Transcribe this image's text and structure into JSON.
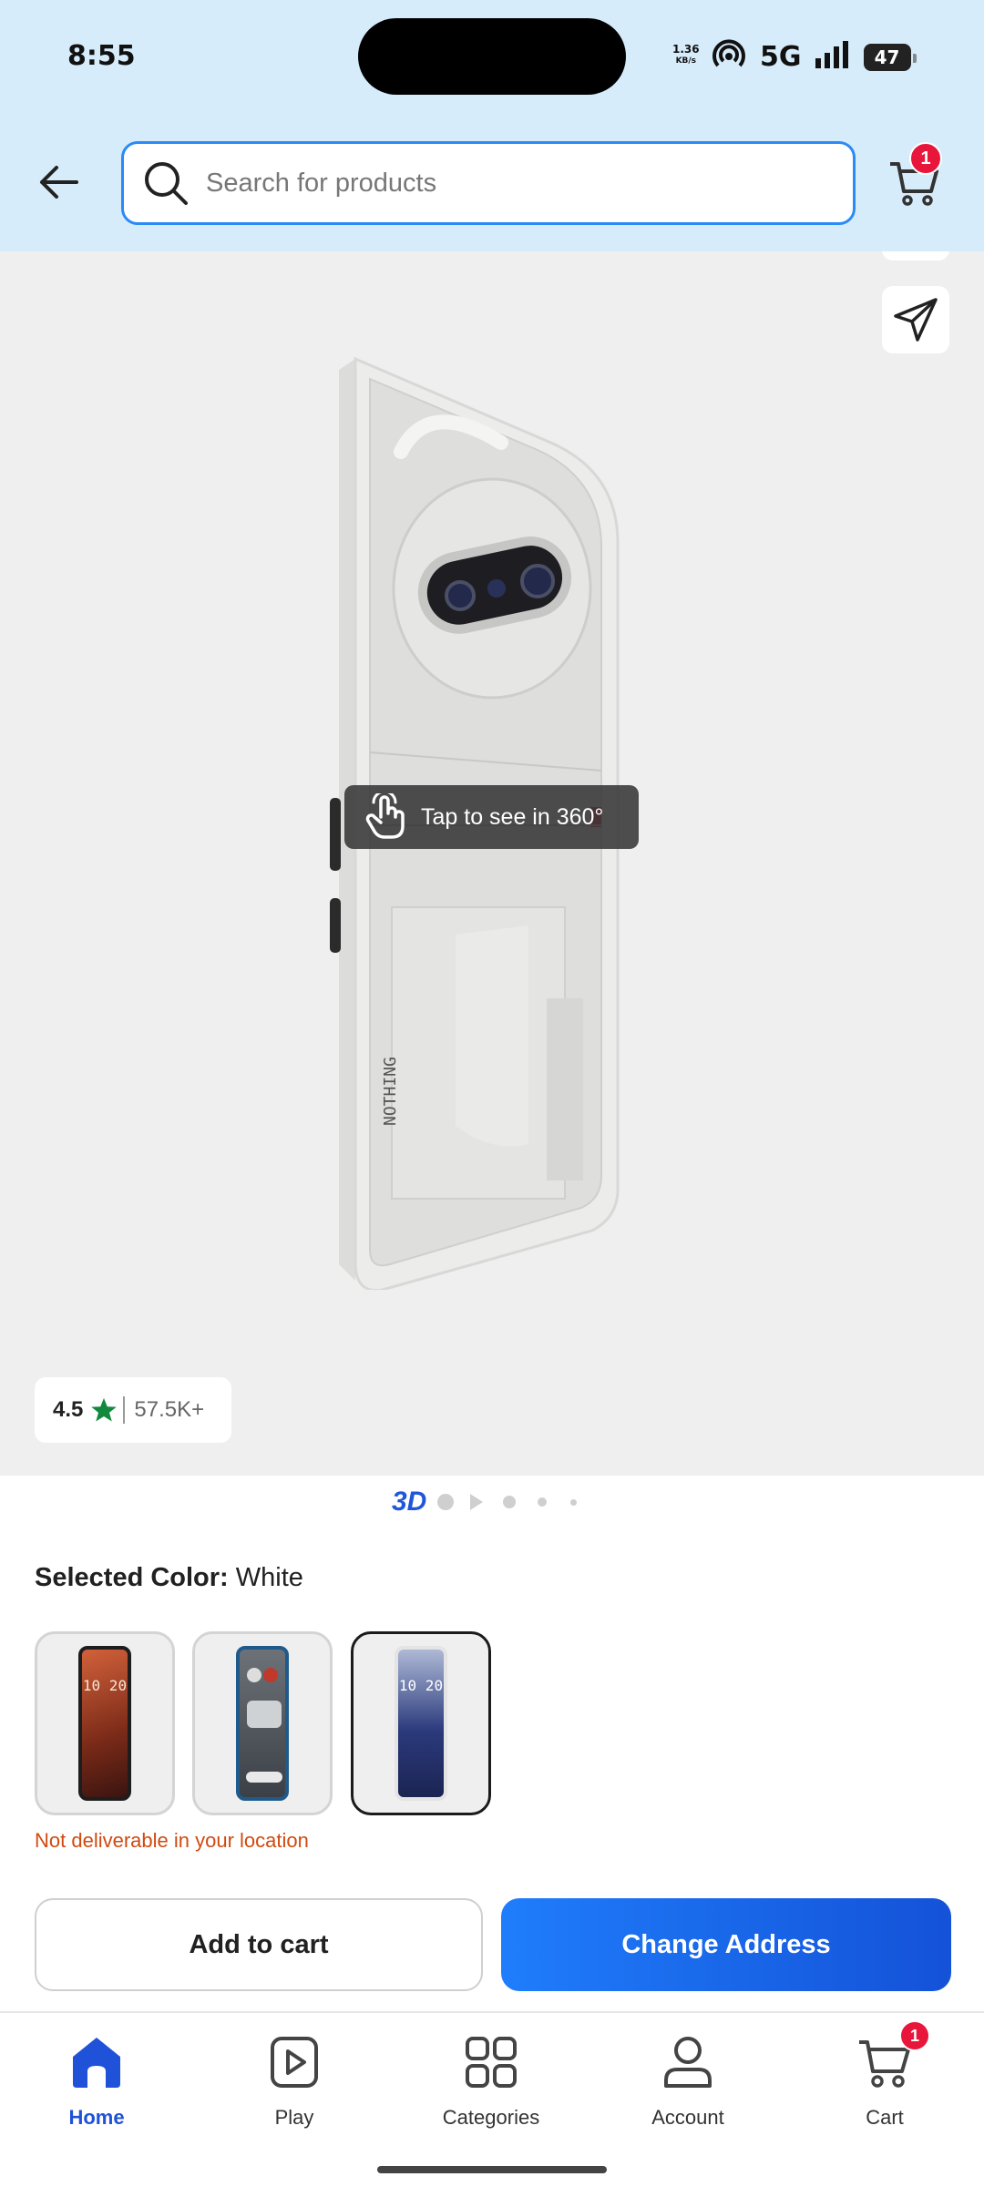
{
  "status_bar": {
    "time": "8:55",
    "net_speed_value": "1.36",
    "net_speed_unit": "KB/s",
    "network": "5G",
    "battery": "47"
  },
  "header": {
    "search_placeholder": "Search for products",
    "cart_count": "1"
  },
  "gallery": {
    "tap_hint": "Tap to see in 360°",
    "phone_brand": "NOTHING",
    "rating_value": "4.5",
    "rating_count": "57.5K+",
    "indicator_3d": "3D",
    "slide_count": 5
  },
  "product": {
    "selected_color_label": "Selected Color:",
    "selected_color_value": "White",
    "swatches": [
      {
        "name": "Orange",
        "selected": false
      },
      {
        "name": "Grey",
        "selected": false
      },
      {
        "name": "White",
        "selected": true
      }
    ],
    "swatch_screen_time": "10 20",
    "delivery_note": "Not deliverable in your location"
  },
  "actions": {
    "add_to_cart": "Add to cart",
    "change_address": "Change Address"
  },
  "bottom_nav": {
    "items": [
      {
        "label": "Home",
        "icon": "home-icon",
        "active": true
      },
      {
        "label": "Play",
        "icon": "play-icon",
        "active": false
      },
      {
        "label": "Categories",
        "icon": "categories-icon",
        "active": false
      },
      {
        "label": "Account",
        "icon": "account-icon",
        "active": false
      },
      {
        "label": "Cart",
        "icon": "cart-icon",
        "active": false
      }
    ],
    "cart_badge": "1"
  },
  "colors": {
    "accent": "#2057d9",
    "header_bg": "#d6ecfb",
    "search_border": "#2a8af6",
    "badge": "#e8163a",
    "warning": "#d14a10",
    "rating_star": "#13893f"
  }
}
